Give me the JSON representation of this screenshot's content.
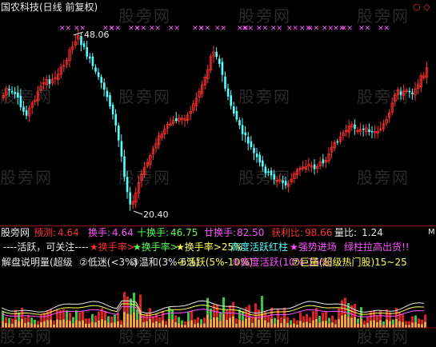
{
  "header": {
    "stock_title": "国农科技(日线 前复权)",
    "window_controls": "○ ◇"
  },
  "watermark_text": "股旁网",
  "price_chart": {
    "high_label": "48.06",
    "low_label": "20.40"
  },
  "indicator_panel": {
    "panel_name": "股旁网",
    "forecast_label": "预测:",
    "forecast_value": "4.64",
    "turnover_label": "换手:",
    "turnover_value": "4.64",
    "ten_turnover_label": "十换手:",
    "ten_turnover_value": "46.75",
    "sum_turnover_label": "廿换手:",
    "sum_turnover_value": "82.50",
    "profit_ratio_label": "获利比:",
    "profit_ratio_value": "98.66",
    "volume_ratio_label": "量比:",
    "volume_ratio_value": "1.24",
    "corner_letter": "M",
    "line2_a": "----活跃，可关注----",
    "line2_b": "★换手率>",
    "line2_c": "★换手率>",
    "line2_d": "★换手率>25%",
    "line2_e": "高度活跃红柱",
    "line2_f": "★强势进场",
    "line2_g": "绿柱拉高出货!!",
    "line3_a": "解盘说明",
    "line3_b": "量(超级",
    "line3_c": "②低迷(<3%)",
    "line3_d": "③温和(3%-5%)",
    "line3_e": "④活跃(5%-10%)",
    "line3_f": "⑤高度活跃(10%-15%)",
    "line3_g": "⑦巨量(超级热门股)15~25"
  },
  "colors": {
    "up": "#ff3030",
    "down": "#54ffff",
    "background": "#000000",
    "text_yellow": "#ffff54",
    "text_magenta": "#ff54ff",
    "text_green": "#54ff54",
    "text_white": "#e8e8e8",
    "bar_green": "#38c838",
    "bar_red": "#e02020",
    "bar_orange": "#f4a234"
  }
}
